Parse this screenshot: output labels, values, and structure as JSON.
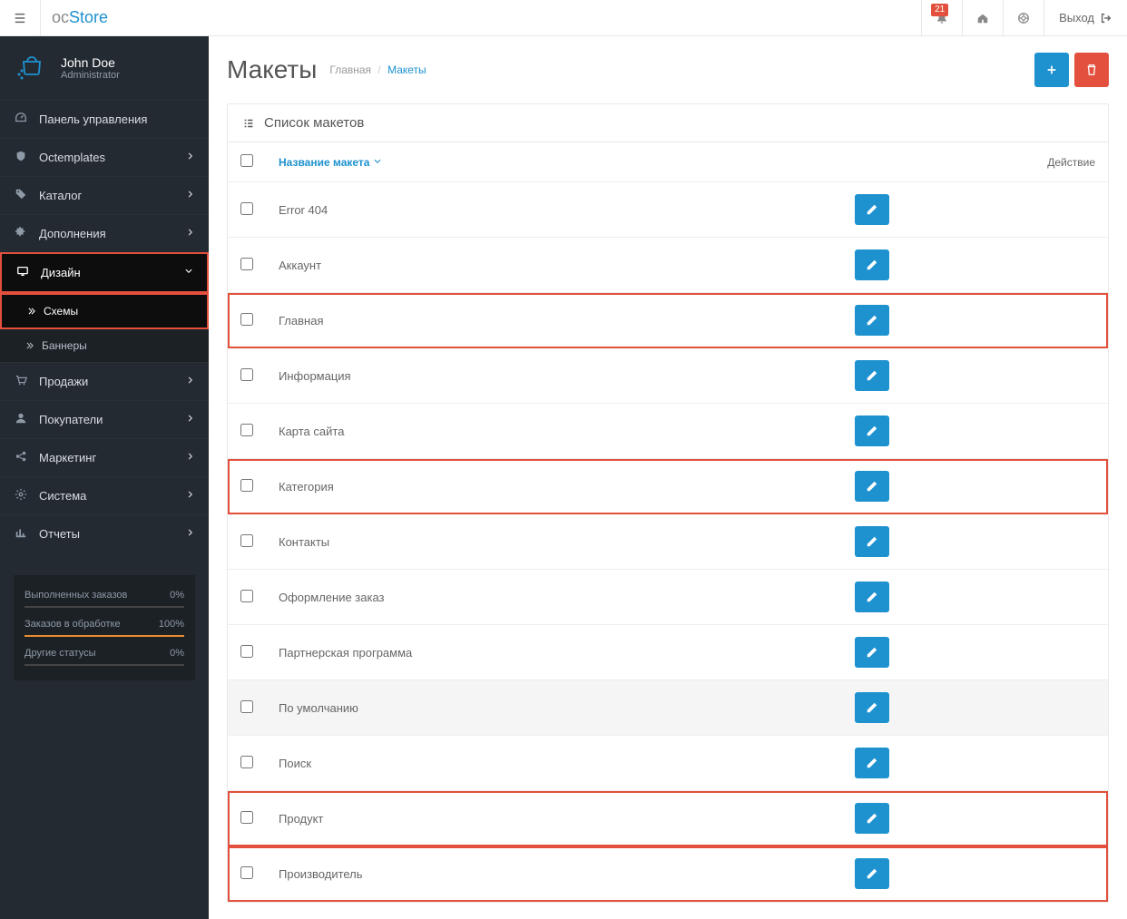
{
  "header": {
    "brand_prefix": "oc",
    "brand_name": "Store",
    "notif_count": "21",
    "logout_label": "Выход"
  },
  "user": {
    "name": "John Doe",
    "role": "Administrator"
  },
  "sidebar": {
    "items": [
      {
        "icon": "dashboard",
        "label": "Панель управления",
        "has_children": false
      },
      {
        "icon": "shield",
        "label": "Octemplates",
        "has_children": true
      },
      {
        "icon": "tag",
        "label": "Каталог",
        "has_children": true
      },
      {
        "icon": "puzzle",
        "label": "Дополнения",
        "has_children": true
      },
      {
        "icon": "monitor",
        "label": "Дизайн",
        "has_children": true,
        "active": true
      },
      {
        "icon": "cart",
        "label": "Продажи",
        "has_children": true
      },
      {
        "icon": "user",
        "label": "Покупатели",
        "has_children": true
      },
      {
        "icon": "share",
        "label": "Маркетинг",
        "has_children": true
      },
      {
        "icon": "gear",
        "label": "Система",
        "has_children": true
      },
      {
        "icon": "chart",
        "label": "Отчеты",
        "has_children": true
      }
    ],
    "design_sub": [
      {
        "label": "Схемы",
        "active": true
      },
      {
        "label": "Баннеры",
        "active": false
      }
    ]
  },
  "stats": {
    "rows": [
      {
        "label": "Выполненных заказов",
        "value": "0%",
        "pct": 0,
        "color": "blue"
      },
      {
        "label": "Заказов в обработке",
        "value": "100%",
        "pct": 100,
        "color": "orange"
      },
      {
        "label": "Другие статусы",
        "value": "0%",
        "pct": 0,
        "color": "blue"
      }
    ]
  },
  "page": {
    "title": "Макеты",
    "bc_home": "Главная",
    "bc_current": "Макеты"
  },
  "panel": {
    "heading": "Список макетов",
    "col_name": "Название макета",
    "col_action": "Действие"
  },
  "rows": [
    {
      "name": "Error 404",
      "hl": false
    },
    {
      "name": "Аккаунт",
      "hl": false
    },
    {
      "name": "Главная",
      "hl": true
    },
    {
      "name": "Информация",
      "hl": false
    },
    {
      "name": "Карта сайта",
      "hl": false
    },
    {
      "name": "Категория",
      "hl": true
    },
    {
      "name": "Контакты",
      "hl": false
    },
    {
      "name": "Оформление заказ",
      "hl": false
    },
    {
      "name": "Партнерская программа",
      "hl": false
    },
    {
      "name": "По умолчанию",
      "hl": false,
      "default": true
    },
    {
      "name": "Поиск",
      "hl": false
    },
    {
      "name": "Продукт",
      "hl": true
    },
    {
      "name": "Производитель",
      "hl": true
    }
  ]
}
